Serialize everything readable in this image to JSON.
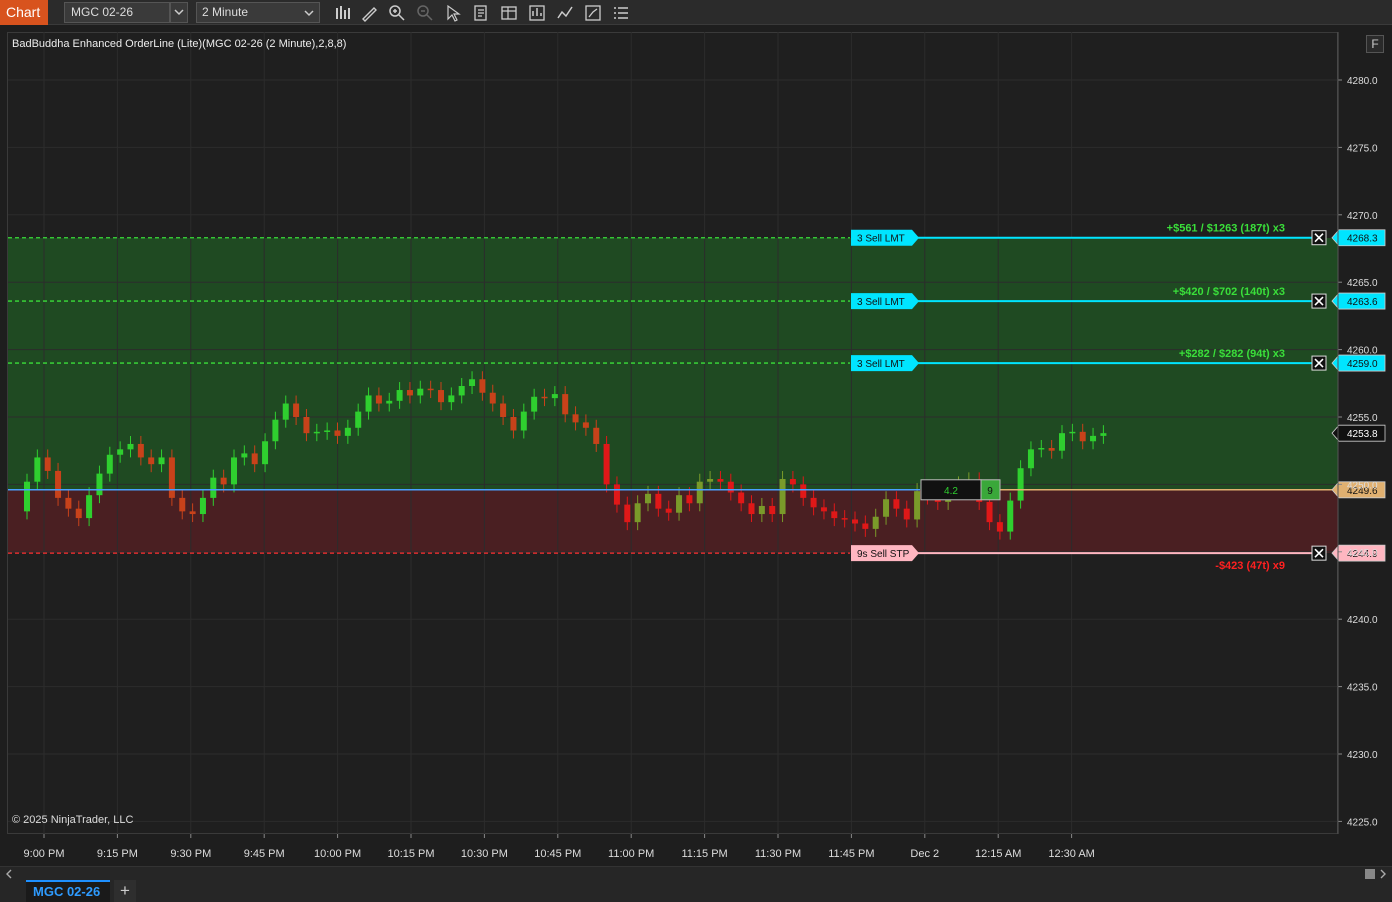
{
  "toolbar": {
    "chart_label": "Chart",
    "instrument": "MGC 02-26",
    "period": "2 Minute",
    "icons": [
      "bar-type-icon",
      "pencil-icon",
      "zoom-in-icon",
      "zoom-out-icon",
      "pointer-icon",
      "properties-icon",
      "data-box-icon",
      "strategies-icon",
      "indicators-icon",
      "templates-icon",
      "list-icon"
    ]
  },
  "chart": {
    "indicator_title": "BadBuddha Enhanced OrderLine (Lite)(MGC 02-26 (2 Minute),2,8,8)",
    "copyright": "© 2025 NinjaTrader, LLC",
    "f_button": "F",
    "price_axis": [
      "4280.0",
      "4275.0",
      "4270.0",
      "4265.0",
      "4260.0",
      "4255.0",
      "4250.0",
      "4245.0",
      "4240.0",
      "4235.0",
      "4230.0",
      "4225.0"
    ],
    "time_axis": [
      "9:00 PM",
      "9:15 PM",
      "9:30 PM",
      "9:45 PM",
      "10:00 PM",
      "10:15 PM",
      "10:30 PM",
      "10:45 PM",
      "11:00 PM",
      "11:15 PM",
      "11:30 PM",
      "11:45 PM",
      "Dec 2",
      "12:15 AM",
      "12:30 AM"
    ],
    "orders": [
      {
        "label": "3  Sell LMT",
        "pnl": "+$561 / $1263 (187t) x3",
        "price": "4268.3"
      },
      {
        "label": "3  Sell LMT",
        "pnl": "+$420 / $702 (140t) x3",
        "price": "4263.6"
      },
      {
        "label": "3  Sell LMT",
        "pnl": "+$282 / $282 (94t) x3",
        "price": "4259.0"
      },
      {
        "label": "9s  Sell STP",
        "pnl": "-$423 (47t) x9",
        "price": "4244.9"
      }
    ],
    "last_price": "4253.8",
    "position": {
      "avg_price": "4249.6",
      "avg_value": "4.2",
      "qty": "9"
    },
    "colors": {
      "target": "#00e5ff",
      "stop": "#ffb6c1",
      "position": "#e0b070",
      "profit_zone": "#1f4a22",
      "loss_zone": "#4a1f1f",
      "up_candle": "#2fcf2f",
      "down_candle": "#cf3a10"
    }
  },
  "tabs": [
    {
      "label": "MGC 02-26"
    }
  ],
  "add_tab": "+"
}
